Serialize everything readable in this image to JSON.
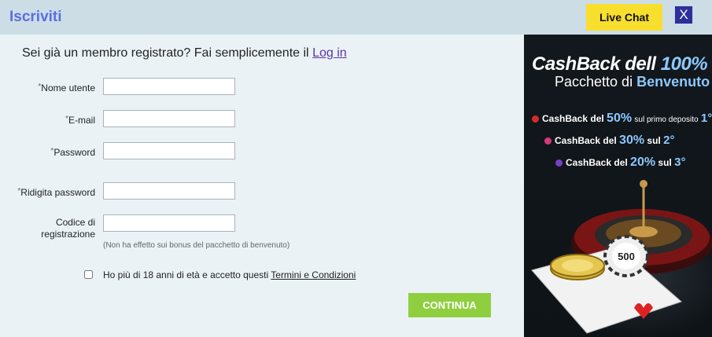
{
  "header": {
    "title": "Iscriviti",
    "live_chat_label": "Live Chat",
    "close_label": "X"
  },
  "intro": {
    "text": "Sei già un membro registrato? Fai semplicemente il",
    "login_link": "Log in"
  },
  "form": {
    "required_mark": "*",
    "fields": {
      "username": {
        "label": "Nome utente",
        "value": "",
        "placeholder": ""
      },
      "email": {
        "label": "E-mail",
        "value": "",
        "placeholder": ""
      },
      "password": {
        "label": "Password",
        "value": "",
        "placeholder": ""
      },
      "confirm_password": {
        "label": "Ridigita password",
        "value": "",
        "placeholder": ""
      },
      "registration_code": {
        "label_line1": "Codice di",
        "label_line2": "registrazione",
        "value": "",
        "placeholder": ""
      }
    },
    "code_note": "(Non ha effetto sui bonus del pacchetto di benvenuto)",
    "terms": {
      "text": "Ho più di 18 anni di età e accetto questi",
      "link": "Termini e Condizioni",
      "checked": false
    },
    "continue_label": "CONTINUA"
  },
  "banner": {
    "title_part1": "CashBack dell",
    "title_part2": "100%",
    "subtitle_part1": "Pacchetto di",
    "subtitle_part2": "Benvenuto",
    "offers": [
      {
        "prefix": "CashBack del",
        "pct": "50%",
        "suffix": "sul primo deposito",
        "ord": "1°",
        "dot_color": "#d62b2b"
      },
      {
        "prefix": "CashBack del",
        "pct": "30%",
        "suffix": "sul",
        "ord": "2°",
        "dot_color": "#d6387c"
      },
      {
        "prefix": "CashBack del",
        "pct": "20%",
        "suffix": "sul",
        "ord": "3°",
        "dot_color": "#7a3fc9"
      }
    ],
    "chip_text": "500"
  },
  "colors": {
    "accent": "#5a6fe0",
    "live_chat": "#f8df2e",
    "close": "#2d2f9a",
    "continue": "#8fcf3f",
    "banner_bg": "#12181d"
  }
}
